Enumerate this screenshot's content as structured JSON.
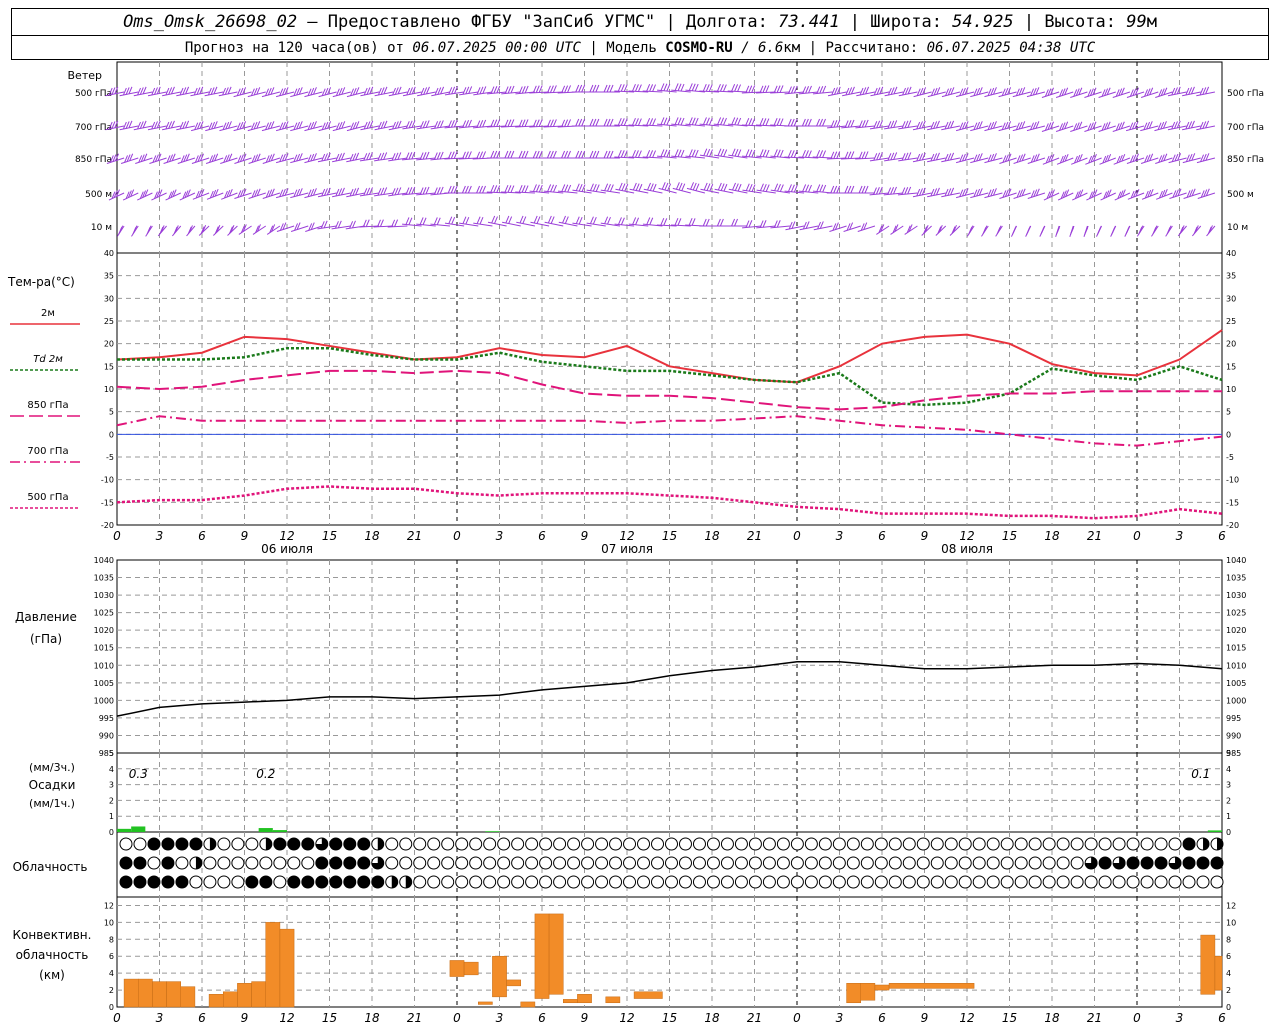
{
  "header": {
    "station": "Oms_Omsk_26698_02",
    "dash": " – ",
    "provided": "Предоставлено ФГБУ \"ЗапСиб УГМС\"",
    "sep": " | ",
    "lon_label": "Долгота: ",
    "lon_value": "73.441",
    "lat_label": "Широта: ",
    "lat_value": "54.925",
    "alt_label": "Высота: ",
    "alt_value": "99",
    "alt_unit": "м",
    "forecast_label": "Прогноз на 120 часа(ов)  от ",
    "forecast_start": "06.07.2025 00:00 UTC",
    "model_label": " | Модель ",
    "model_name": "COSMO-RU",
    "model_res": " / 6.6",
    "model_res_unit": "км",
    "calc_label": " | Рассчитано: ",
    "calc_time": "06.07.2025 04:38 UTC"
  },
  "colors": {
    "t2m": "#e8323c",
    "td2m": "#1a7a1a",
    "t850": "#e0147a",
    "wind": "#9a3fd8",
    "precip": "#22c222",
    "convective": "#f28c28"
  },
  "icons": {
    "cloud": "cloud-cover-circle-icon",
    "wind": "wind-barb-icon"
  },
  "time_axis": {
    "hour_labels": [
      "0",
      "3",
      "6",
      "9",
      "12",
      "15",
      "18",
      "21",
      "0",
      "3",
      "6",
      "9",
      "12",
      "15",
      "18",
      "21",
      "0",
      "3",
      "6",
      "9",
      "12",
      "15",
      "18",
      "21",
      "0",
      "3",
      "6"
    ],
    "day_labels": [
      "06 июля",
      "07 июля",
      "08 июля"
    ]
  },
  "wind_panel": {
    "title": "Ветер",
    "levels": [
      "500 гПа",
      "700 гПа",
      "850 гПа",
      "500  м",
      "10   м"
    ]
  },
  "chart_data": [
    {
      "type": "line",
      "title": "Тем-ра(°С)",
      "x_unit": "hours from 06.07.2025 00:00 UTC",
      "ylim": [
        -20,
        40
      ],
      "yticks": [
        40,
        35,
        30,
        25,
        20,
        15,
        10,
        5,
        0,
        -5,
        -10,
        -15,
        -20
      ],
      "x": [
        0,
        3,
        6,
        9,
        12,
        15,
        18,
        21,
        24,
        27,
        30,
        33,
        36,
        39,
        42,
        45,
        48,
        51,
        54,
        57,
        60,
        63,
        66,
        69,
        72,
        75,
        78
      ],
      "series": [
        {
          "name": "2м",
          "values": [
            16.5,
            17,
            18,
            21.5,
            21,
            19.5,
            18,
            16.5,
            17,
            19,
            17.5,
            17,
            19.5,
            15,
            13.5,
            12,
            11.5,
            15,
            20,
            21.5,
            22,
            20,
            15.5,
            13.5,
            13,
            16.5,
            23
          ]
        },
        {
          "name": "Td 2м",
          "values": [
            16.5,
            16.5,
            16.5,
            17,
            19,
            19,
            17.5,
            16.5,
            16.5,
            18,
            16,
            15,
            14,
            14,
            13,
            12,
            11.5,
            13.5,
            7,
            6.5,
            7,
            9,
            14.5,
            13,
            12,
            15,
            12
          ]
        },
        {
          "name": "850 гПа",
          "values": [
            10.5,
            10,
            10.5,
            12,
            13,
            14,
            14,
            13.5,
            14,
            13.5,
            11,
            9,
            8.5,
            8.5,
            8,
            7,
            6,
            5.5,
            6,
            7.5,
            8.5,
            9,
            9,
            9.5,
            9.5,
            9.5,
            9.5
          ]
        },
        {
          "name": "700 гПа",
          "values": [
            2,
            4,
            3,
            3,
            3,
            3,
            3,
            3,
            3,
            3,
            3,
            3,
            2.5,
            3,
            3,
            3.5,
            4,
            3,
            2,
            1.5,
            1,
            0,
            -1,
            -2,
            -2.5,
            -1.5,
            -0.5
          ]
        },
        {
          "name": "500 гПа",
          "values": [
            -15,
            -14.5,
            -14.5,
            -13.5,
            -12,
            -11.5,
            -12,
            -12,
            -13,
            -13.5,
            -13,
            -13,
            -13,
            -13.5,
            -14,
            -15,
            -16,
            -16.5,
            -17.5,
            -17.5,
            -17.5,
            -18,
            -18,
            -18.5,
            -18,
            -16.5,
            -17.5
          ]
        }
      ]
    },
    {
      "type": "line",
      "title": "Давление",
      "ylabel": "(гПа)",
      "ylim": [
        985,
        1040
      ],
      "yticks": [
        1040,
        1035,
        1030,
        1025,
        1020,
        1015,
        1010,
        1005,
        1000,
        995,
        990,
        985
      ],
      "x": [
        0,
        3,
        6,
        9,
        12,
        15,
        18,
        21,
        24,
        27,
        30,
        33,
        36,
        39,
        42,
        45,
        48,
        51,
        54,
        57,
        60,
        63,
        66,
        69,
        72,
        75,
        78
      ],
      "series": [
        {
          "name": "",
          "values": [
            995.5,
            998,
            999,
            999.5,
            1000,
            1001,
            1001,
            1000.5,
            1001,
            1001.5,
            1003,
            1004,
            1005,
            1007,
            1008.5,
            1009.5,
            1011,
            1011,
            1010,
            1009,
            1009,
            1009.5,
            1010,
            1010,
            1010.5,
            1010,
            1009
          ]
        }
      ]
    },
    {
      "type": "bar",
      "title": "Осадки",
      "ylabel_top": "(мм/3ч.)",
      "ylabel_bottom": "(мм/1ч.)",
      "ylim": [
        0,
        5
      ],
      "yticks": [
        5,
        4,
        3,
        2,
        1,
        0
      ],
      "totals_3h": [
        {
          "x": 1.5,
          "label": "0.3"
        },
        {
          "x": 10.5,
          "label": "0.2"
        },
        {
          "x": 76.5,
          "label": "0.1"
        }
      ],
      "bars": [
        {
          "x0": 0,
          "x1": 1,
          "value": 0.2
        },
        {
          "x0": 1,
          "x1": 2,
          "value": 0.35
        },
        {
          "x0": 10,
          "x1": 11,
          "value": 0.25
        },
        {
          "x0": 11,
          "x1": 12,
          "value": 0.12
        },
        {
          "x0": 26,
          "x1": 27,
          "value": 0.05
        },
        {
          "x0": 77,
          "x1": 78,
          "value": 0.1
        }
      ]
    },
    {
      "type": "bar",
      "title": "Облачность",
      "rows": [
        {
          "name": "upper",
          "cover": [
            0,
            0,
            0,
            4,
            4,
            4,
            4,
            4,
            4,
            4,
            4,
            4,
            2,
            2,
            0,
            0,
            0,
            0,
            0,
            0,
            0,
            2,
            2,
            3,
            4,
            4,
            4,
            4,
            4,
            4,
            4,
            3,
            3,
            4,
            4,
            4,
            4,
            4,
            4,
            3,
            3,
            2,
            2,
            0,
            0,
            0,
            0,
            0,
            0,
            0,
            0,
            0,
            0,
            0,
            0,
            0,
            0,
            0,
            0,
            0,
            0,
            0,
            0,
            0,
            0,
            0,
            0,
            0,
            0,
            0,
            0,
            0,
            0,
            0,
            0,
            0,
            0,
            0,
            0,
            0,
            0,
            0,
            0,
            0,
            0,
            0,
            0,
            0,
            0,
            0,
            0,
            0,
            0,
            0,
            0,
            0,
            0,
            0,
            0,
            0,
            0,
            0,
            0,
            0,
            0,
            0,
            0,
            0,
            0,
            0,
            0,
            0,
            0,
            0,
            0,
            0,
            0,
            0,
            0,
            0,
            0,
            0,
            0,
            0,
            0,
            0,
            0,
            0,
            0,
            0,
            0,
            0,
            0,
            0,
            0,
            0,
            0,
            0,
            0,
            0,
            0,
            0,
            0,
            0,
            0,
            0,
            0,
            0,
            0,
            0,
            0,
            0,
            0,
            0,
            0,
            0,
            0,
            0,
            0,
            0,
            0,
            0,
            0,
            0,
            0,
            0,
            0,
            0,
            0,
            0,
            0,
            0,
            4,
            4,
            4,
            4,
            2,
            2,
            2,
            0,
            0
          ]
        },
        {
          "name": "middle",
          "cover": [
            4,
            4,
            4,
            4,
            0,
            0,
            4,
            4,
            0,
            0,
            2,
            2,
            2,
            0,
            0,
            0,
            0,
            0,
            0,
            0,
            0,
            0,
            0,
            0,
            0,
            0,
            0,
            0,
            0,
            0,
            0,
            4,
            4,
            4,
            4,
            4,
            4,
            4,
            4,
            4,
            4,
            3,
            2,
            2,
            0,
            0,
            0,
            0,
            0,
            0,
            0,
            0,
            0,
            0,
            0,
            0,
            0,
            0,
            0,
            0,
            0,
            0,
            0,
            0,
            0,
            0,
            0,
            0,
            0,
            0,
            0,
            0,
            0,
            0,
            0,
            0,
            0,
            0,
            0,
            0,
            0,
            0,
            0,
            0,
            0,
            0,
            0,
            0,
            0,
            0,
            0,
            0,
            0,
            0,
            0,
            0,
            0,
            0,
            0,
            0,
            0,
            0,
            0,
            0,
            0,
            0,
            0,
            0,
            0,
            0,
            0,
            0,
            0,
            0,
            0,
            0,
            0,
            0,
            0,
            0,
            0,
            0,
            0,
            0,
            0,
            0,
            0,
            0,
            0,
            0,
            0,
            0,
            0,
            0,
            0,
            0,
            0,
            0,
            0,
            0,
            0,
            0,
            0,
            0,
            0,
            0,
            0,
            0,
            0,
            0,
            0,
            0,
            0,
            0,
            0,
            0,
            0,
            0,
            3,
            3,
            4,
            4,
            4,
            3,
            3,
            4,
            4,
            3,
            2,
            4,
            4,
            4,
            4,
            3,
            3,
            2,
            4,
            4,
            4,
            4,
            4,
            2,
            0
          ]
        },
        {
          "name": "lower",
          "cover": [
            4,
            4,
            4,
            4,
            4,
            4,
            4,
            4,
            4,
            4,
            4,
            0,
            0,
            0,
            0,
            0,
            0,
            0,
            0,
            4,
            4,
            4,
            4,
            0,
            0,
            0,
            0,
            4,
            4,
            4,
            4,
            4,
            4,
            4,
            4,
            4,
            4,
            4,
            4,
            4,
            4,
            4,
            3,
            2,
            2,
            2,
            0,
            0,
            0,
            0,
            0,
            0,
            0,
            0,
            0,
            0,
            0,
            0,
            0,
            0,
            0,
            0,
            0,
            0,
            0,
            0,
            0,
            0,
            0,
            0,
            0,
            0,
            0,
            0,
            0,
            0,
            0,
            0,
            0,
            0,
            0,
            0,
            0,
            0,
            0,
            0,
            0,
            0,
            0,
            0,
            0,
            0,
            0,
            0,
            0,
            0,
            0,
            0,
            0,
            0,
            0,
            0,
            0,
            0,
            0,
            0,
            0,
            0,
            0,
            0,
            0,
            0,
            0,
            0,
            0,
            0,
            0,
            0,
            0,
            0,
            0,
            0,
            0,
            0,
            0,
            0,
            0,
            0,
            0,
            0,
            0,
            0,
            0,
            0,
            0,
            0,
            0,
            0,
            0,
            0,
            0,
            0,
            0,
            0,
            0,
            0,
            0,
            0,
            0,
            0,
            0,
            0,
            0,
            0,
            0,
            0,
            0,
            0,
            0,
            0,
            0,
            0,
            0,
            0,
            0,
            0,
            0,
            0,
            0,
            0,
            0,
            0,
            0,
            0,
            0,
            0,
            0,
            0,
            0,
            0,
            2
          ]
        }
      ]
    },
    {
      "type": "bar",
      "title": "Конвективн.",
      "subtitle": "облачность",
      "ylabel": "(км)",
      "ylim": [
        0,
        13
      ],
      "yticks": [
        12,
        10,
        8,
        6,
        4,
        2,
        0
      ],
      "bars": [
        {
          "x0": 0.5,
          "x1": 1.5,
          "base": 0,
          "top": 3.3
        },
        {
          "x0": 1.5,
          "x1": 2.5,
          "base": 0,
          "top": 3.3
        },
        {
          "x0": 2.5,
          "x1": 3.5,
          "base": 0,
          "top": 3
        },
        {
          "x0": 3.5,
          "x1": 4.5,
          "base": 0,
          "top": 3
        },
        {
          "x0": 4.5,
          "x1": 5.5,
          "base": 0,
          "top": 2.4
        },
        {
          "x0": 6.5,
          "x1": 7.5,
          "base": 0,
          "top": 1.5
        },
        {
          "x0": 7.5,
          "x1": 8.5,
          "base": 0,
          "top": 1.8
        },
        {
          "x0": 8.5,
          "x1": 9.5,
          "base": 0,
          "top": 2.8
        },
        {
          "x0": 9.5,
          "x1": 10.5,
          "base": 0,
          "top": 3
        },
        {
          "x0": 10.5,
          "x1": 11.5,
          "base": 0,
          "top": 10
        },
        {
          "x0": 11.5,
          "x1": 12.5,
          "base": 0,
          "top": 9.2
        },
        {
          "x0": 23.5,
          "x1": 24.5,
          "base": 3.6,
          "top": 5.5
        },
        {
          "x0": 24.5,
          "x1": 25.5,
          "base": 3.8,
          "top": 5.3
        },
        {
          "x0": 25.5,
          "x1": 26.5,
          "base": 0.3,
          "top": 0.6
        },
        {
          "x0": 26.5,
          "x1": 27.5,
          "base": 1.2,
          "top": 6
        },
        {
          "x0": 27.5,
          "x1": 28.5,
          "base": 2.5,
          "top": 3.2
        },
        {
          "x0": 28.5,
          "x1": 29.5,
          "base": 0,
          "top": 0.6
        },
        {
          "x0": 29.5,
          "x1": 30.5,
          "base": 1,
          "top": 11
        },
        {
          "x0": 30.5,
          "x1": 31.5,
          "base": 1.5,
          "top": 11
        },
        {
          "x0": 31.5,
          "x1": 32.5,
          "base": 0.5,
          "top": 0.9
        },
        {
          "x0": 32.5,
          "x1": 33.5,
          "base": 0.5,
          "top": 1.5
        },
        {
          "x0": 34.5,
          "x1": 35.5,
          "base": 0.5,
          "top": 1.2
        },
        {
          "x0": 36.5,
          "x1": 38.5,
          "base": 1,
          "top": 1.8
        },
        {
          "x0": 51.5,
          "x1": 52.5,
          "base": 0.5,
          "top": 2.8
        },
        {
          "x0": 52.5,
          "x1": 53.5,
          "base": 0.8,
          "top": 2.8
        },
        {
          "x0": 53.5,
          "x1": 54.5,
          "base": 2,
          "top": 2.6
        },
        {
          "x0": 54.5,
          "x1": 60.5,
          "base": 2.2,
          "top": 2.8
        },
        {
          "x0": 76.5,
          "x1": 77.5,
          "base": 1.5,
          "top": 8.5
        },
        {
          "x0": 77.5,
          "x1": 78,
          "base": 2,
          "top": 6
        }
      ]
    }
  ]
}
